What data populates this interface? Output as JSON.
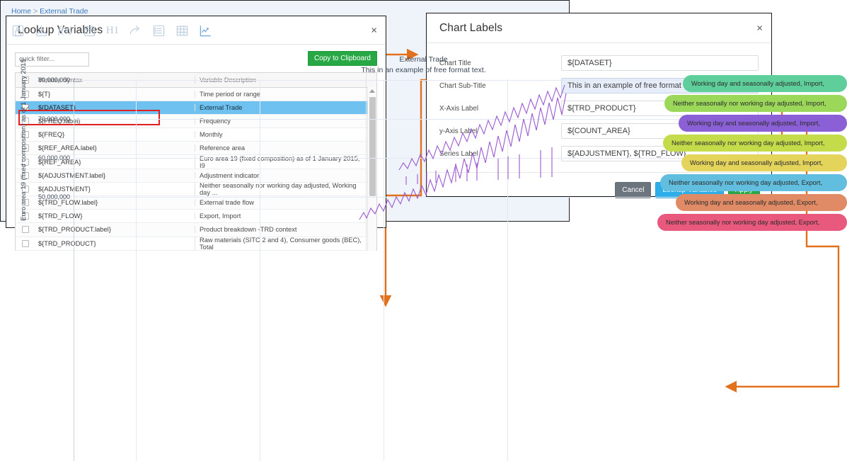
{
  "lookup_dialog": {
    "title": "Lookup Variables",
    "close_label": "×",
    "quick_filter_placeholder": "quick filter...",
    "copy_button": "Copy to Clipboard",
    "columns": [
      "Variable Syntax",
      "Variable Description"
    ],
    "rows": [
      {
        "syntax": "${T}",
        "description": "Time period or range",
        "checked": false,
        "selected": false
      },
      {
        "syntax": "${DATASET}",
        "description": "External Trade",
        "checked": true,
        "selected": true
      },
      {
        "syntax": "${FREQ.label}",
        "description": "Frequency",
        "checked": false,
        "selected": false
      },
      {
        "syntax": "${FREQ}",
        "description": "Monthly",
        "checked": false,
        "selected": false
      },
      {
        "syntax": "${REF_AREA.label}",
        "description": "Reference area",
        "checked": false,
        "selected": false
      },
      {
        "syntax": "${REF_AREA}",
        "description": "Euro area 19 (fixed composition) as of 1 January 2015, I9",
        "checked": false,
        "selected": false
      },
      {
        "syntax": "${ADJUSTMENT.label}",
        "description": "Adjustment indicator",
        "checked": false,
        "selected": false
      },
      {
        "syntax": "${ADJUSTMENT}",
        "description": "Neither seasonally nor working day adjusted, Working day ...",
        "checked": false,
        "selected": false
      },
      {
        "syntax": "${TRD_FLOW.label}",
        "description": "External trade flow",
        "checked": false,
        "selected": false
      },
      {
        "syntax": "${TRD_FLOW}",
        "description": "Export, Import",
        "checked": false,
        "selected": false
      },
      {
        "syntax": "${TRD_PRODUCT.label}",
        "description": "Product breakdown -TRD context",
        "checked": false,
        "selected": false
      },
      {
        "syntax": "${TRD_PRODUCT}",
        "description": "Raw materials (SITC 2 and 4), Consumer goods (BEC), Total",
        "checked": false,
        "selected": false
      }
    ]
  },
  "chart_labels_dialog": {
    "title": "Chart Labels",
    "close_label": "×",
    "fields": [
      {
        "label": "Chart Title",
        "value": "${DATASET}",
        "highlighted": false
      },
      {
        "label": "Chart Sub-Title",
        "value": "This in an example of free format text.",
        "highlighted": true
      },
      {
        "label": "X-Axis Label",
        "value": "${TRD_PRODUCT}",
        "highlighted": false
      },
      {
        "label": "y-Axis Label",
        "value": "${COUNT_AREA}",
        "highlighted": false
      },
      {
        "label": "Series Label",
        "value": "${ADJUSTMENT}, ${TRD_FLOW},",
        "highlighted": false
      }
    ],
    "buttons": {
      "cancel": "Cancel",
      "lookup": "Lookup Variables",
      "apply": "Apply"
    }
  },
  "chart_panel": {
    "breadcrumb": {
      "home": "Home",
      "separator": ">",
      "current": "External Trade"
    },
    "toolbar": [
      {
        "name": "save-icon",
        "glyph": "save"
      },
      {
        "name": "download-icon",
        "glyph": "download"
      },
      {
        "name": "function-icon",
        "glyph": "fx"
      },
      {
        "name": "calendar-icon",
        "glyph": "calendar"
      },
      {
        "name": "heading-icon",
        "glyph": "H1"
      },
      {
        "name": "share-icon",
        "glyph": "share"
      },
      {
        "name": "list-icon",
        "glyph": "list"
      },
      {
        "name": "table-icon",
        "glyph": "table"
      },
      {
        "name": "chart-icon",
        "glyph": "chart"
      }
    ]
  },
  "chart_data": {
    "type": "line",
    "title": "External Trade",
    "subtitle": "This in an example of free format text.",
    "xlabel": "",
    "ylabel": "Euro area 19 (fixed composition) as of 1 January 2015",
    "ylim": [
      45000000,
      82000000
    ],
    "yticks": [
      "80,000,000",
      "70,000,000",
      "60,000,000",
      "50,000,000"
    ],
    "ytick_values": [
      80000000,
      70000000,
      60000000,
      50000000
    ],
    "grid": true,
    "legend_position": "overlay-right",
    "series": [
      {
        "name": "Working day and seasonally adjusted, Import,",
        "color": "#5ecf9a"
      },
      {
        "name": "Neither seasonally nor working day adjusted, Import,",
        "color": "#9bd85a"
      },
      {
        "name": "Working day and seasonally adjusted, Import,",
        "color": "#8b5fd6"
      },
      {
        "name": "Neither seasonally nor working day adjusted, Import,",
        "color": "#c4dc4a"
      },
      {
        "name": "Working day and seasonally adjusted, Import,",
        "color": "#e4d45c"
      },
      {
        "name": "Neither seasonally nor working day adjusted, Export,",
        "color": "#62bede"
      },
      {
        "name": "Working day and seasonally adjusted, Export,",
        "color": "#e08b66"
      },
      {
        "name": "Neither seasonally nor working day adjusted, Export,",
        "color": "#e8597d"
      }
    ]
  }
}
